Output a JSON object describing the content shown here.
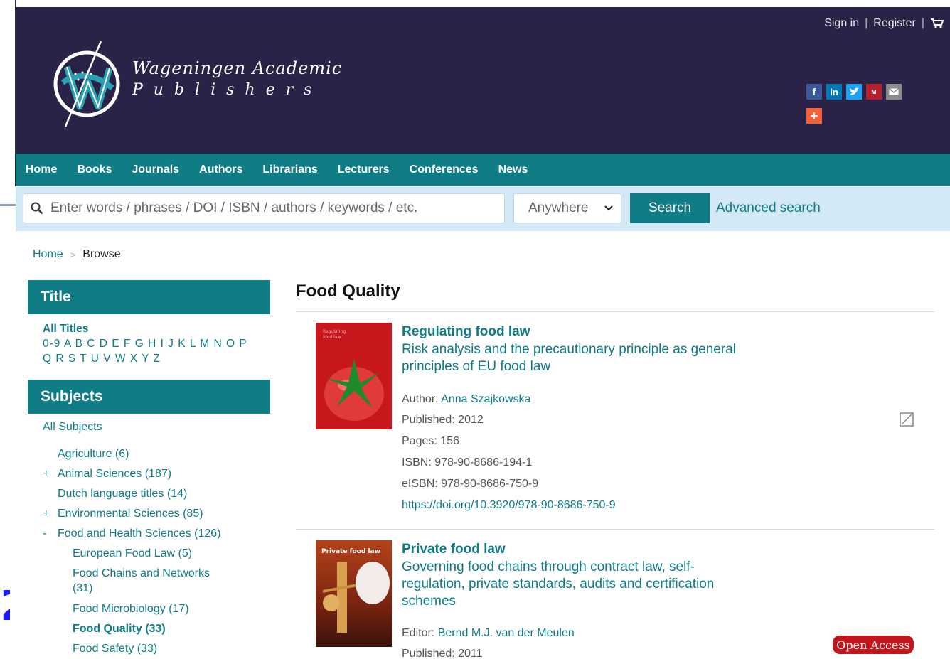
{
  "header": {
    "sign_in": "Sign in",
    "register": "Register",
    "separator": "|",
    "brand_line1": "Wageningen Academic",
    "brand_line2": "Publishers"
  },
  "social": {
    "icons": [
      "facebook-icon",
      "linkedin-icon",
      "twitter-icon",
      "mendeley-icon",
      "email-icon",
      "addthis-plus-icon"
    ],
    "colors": {
      "facebook": "#3b5998",
      "linkedin": "#0077b5",
      "twitter": "#1da1f2",
      "mendeley": "#b61f2e",
      "email": "#8b8b8b",
      "plus": "#f4623a"
    }
  },
  "nav": {
    "items": [
      "Home",
      "Books",
      "Journals",
      "Authors",
      "Librarians",
      "Lecturers",
      "Conferences",
      "News"
    ]
  },
  "search": {
    "placeholder": "Enter words / phrases / DOI / ISBN / authors / keywords / etc.",
    "scope": "Anywhere",
    "button": "Search",
    "advanced": "Advanced search"
  },
  "breadcrumb": {
    "home": "Home",
    "sep": ">",
    "current": "Browse"
  },
  "sidebar": {
    "title_heading": "Title",
    "all_titles": "All Titles",
    "letters_line1": "0-9 A B C D E F G H I J K L M N O P",
    "letters_line2": "Q R S T U V W X Y Z",
    "subjects_heading": "Subjects",
    "all_subjects": "All Subjects",
    "subjects": [
      {
        "label": "Agriculture (6)",
        "prefix": ""
      },
      {
        "label": "Animal Sciences (187)",
        "prefix": "+"
      },
      {
        "label": "Dutch language titles (14)",
        "prefix": ""
      },
      {
        "label": "Environmental Sciences (85)",
        "prefix": "+"
      },
      {
        "label": "Food and Health Sciences (126)",
        "prefix": "-"
      }
    ],
    "children": [
      {
        "label": "European Food Law (5)"
      },
      {
        "label": "Food Chains and Networks",
        "label2": "(31)"
      },
      {
        "label": "Food Microbiology (17)"
      },
      {
        "label": "Food Quality (33)"
      },
      {
        "label": "Food Safety (33)"
      }
    ]
  },
  "main": {
    "title": "Food Quality",
    "books": [
      {
        "title": "Regulating food law",
        "subtitle": "Risk analysis and the precautionary principle as general principles of EU food law",
        "author_label": "Author: ",
        "author": "Anna Szajkowska",
        "published": "Published: 2012",
        "pages": "Pages: 156",
        "isbn": "ISBN: 978-90-8686-194-1",
        "eisbn": "eISBN: 978-90-8686-750-9",
        "doi": "https://doi.org/10.3920/978-90-8686-750-9",
        "cover_text": "Regulating food law",
        "cover_color": "#c8161d"
      },
      {
        "title": "Private food law",
        "subtitle": "Governing food chains through contract law, self-regulation, private standards, audits and certification schemes",
        "editor_label": "Editor: ",
        "editor": "Bernd M.J. van der Meulen",
        "published": "Published: 2011",
        "cover_text": "Private food law",
        "cover_color": "#8a2a12",
        "badge": "Open Access"
      }
    ]
  }
}
